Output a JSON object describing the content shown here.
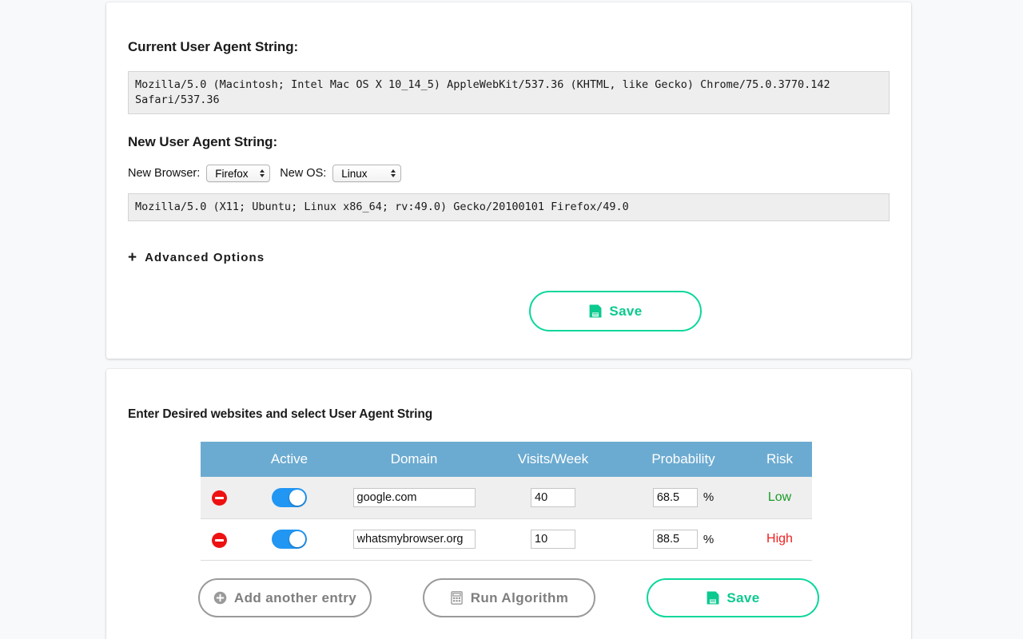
{
  "ua_card": {
    "current_label": "Current User Agent String:",
    "current_value": "Mozilla/5.0 (Macintosh; Intel Mac OS X 10_14_5) AppleWebKit/537.36 (KHTML, like Gecko) Chrome/75.0.3770.142 Safari/537.36",
    "new_label": "New User Agent String:",
    "browser_label": "New Browser:",
    "browser_value": "Firefox",
    "os_label": "New OS:",
    "os_value": "Linux",
    "new_value": "Mozilla/5.0 (X11; Ubuntu; Linux x86_64; rv:49.0) Gecko/20100101 Firefox/49.0",
    "advanced_options": "Advanced Options",
    "advanced_plus": "+",
    "save_label": "Save",
    "save_icon": "save-floppy-icon"
  },
  "sites_card": {
    "title": "Enter Desired websites and select User Agent String",
    "columns": [
      "",
      "Active",
      "Domain",
      "Visits/Week",
      "Probability",
      "Risk"
    ],
    "percent_symbol": "%",
    "rows": [
      {
        "delete_icon": "remove-circle-icon",
        "active": true,
        "domain": "google.com",
        "visits": "40",
        "probability": "68.5",
        "risk": "Low"
      },
      {
        "delete_icon": "remove-circle-icon",
        "active": true,
        "domain": "whatsmybrowser.org",
        "visits": "10",
        "probability": "88.5",
        "risk": "High"
      }
    ],
    "add_label": "Add another entry",
    "add_icon": "plus-circle-icon",
    "run_label": "Run Algorithm",
    "run_icon": "calculator-icon",
    "save_label": "Save",
    "save_icon": "save-floppy-icon"
  },
  "colors": {
    "page_bg": "#f7f9fb",
    "accent_green": "#0bd79b",
    "table_header_blue": "#6cabd1",
    "toggle_blue": "#2196f3",
    "delete_red": "#ee1111",
    "risk_low": "#1a9b28",
    "risk_high": "#ef2020"
  }
}
